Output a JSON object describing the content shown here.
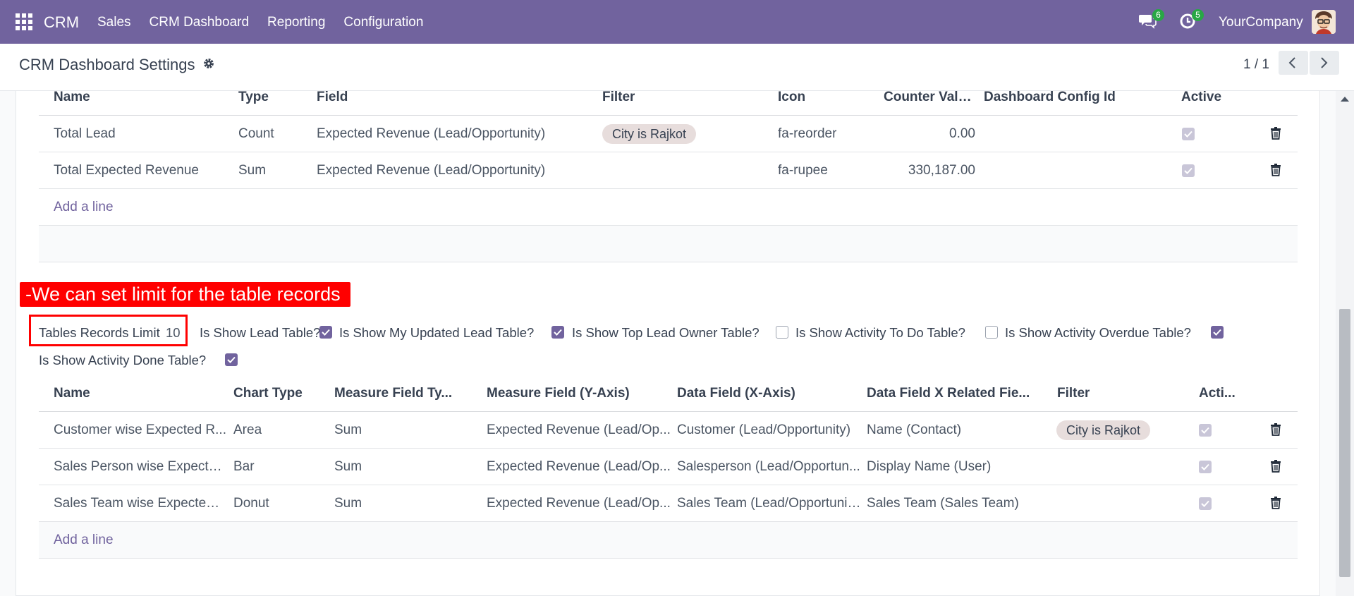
{
  "navbar": {
    "brand": "CRM",
    "menu": [
      "Sales",
      "CRM Dashboard",
      "Reporting",
      "Configuration"
    ],
    "messages_count": "6",
    "activities_count": "5",
    "company": "YourCompany",
    "colors": {
      "navbar": "#71639e",
      "badge": "#28a745"
    }
  },
  "control": {
    "title": "CRM Dashboard Settings",
    "pager": "1 / 1"
  },
  "counter_table": {
    "headers": [
      "Name",
      "Type",
      "Field",
      "Filter",
      "Icon",
      "Counter Values",
      "Dashboard Config Id",
      "Active"
    ],
    "rows": [
      {
        "name": "Total Lead",
        "type": "Count",
        "field": "Expected Revenue (Lead/Opportunity)",
        "filter": "City is Rajkot",
        "icon": "fa-reorder",
        "counter": "0.00",
        "config": "",
        "active": true
      },
      {
        "name": "Total Expected Revenue",
        "type": "Sum",
        "field": "Expected Revenue (Lead/Opportunity)",
        "filter": "",
        "icon": "fa-rupee",
        "counter": "330,187.00",
        "config": "",
        "active": true
      }
    ],
    "add_line": "Add a line"
  },
  "annotation": "-We can set limit for the table records",
  "options": {
    "limit_label": "Tables Records Limit",
    "limit_value": "10",
    "items": [
      {
        "label": "Is Show Lead Table?",
        "checked": true
      },
      {
        "label": "Is Show My Updated Lead Table?",
        "checked": true
      },
      {
        "label": "Is Show Top Lead Owner Table?",
        "checked": false
      },
      {
        "label": "Is Show Activity To Do Table?",
        "checked": false
      },
      {
        "label": "Is Show Activity Overdue Table?",
        "checked": true
      },
      {
        "label": "Is Show Activity Done Table?",
        "checked": true
      }
    ]
  },
  "chart_table": {
    "headers": [
      "Name",
      "Chart Type",
      "Measure Field Ty...",
      "Measure Field (Y-Axis)",
      "Data Field (X-Axis)",
      "Data Field X Related Fie...",
      "Filter",
      "Acti..."
    ],
    "rows": [
      {
        "name": "Customer wise Expected R...",
        "chart_type": "Area",
        "measure_type": "Sum",
        "measure_field": "Expected Revenue (Lead/Op...",
        "data_field": "Customer (Lead/Opportunity)",
        "related": "Name (Contact)",
        "filter": "City is Rajkot",
        "active": true
      },
      {
        "name": "Sales Person wise Expected...",
        "chart_type": "Bar",
        "measure_type": "Sum",
        "measure_field": "Expected Revenue (Lead/Op...",
        "data_field": "Salesperson (Lead/Opportun...",
        "related": "Display Name (User)",
        "filter": "",
        "active": true
      },
      {
        "name": "Sales Team wise Expected ...",
        "chart_type": "Donut",
        "measure_type": "Sum",
        "measure_field": "Expected Revenue (Lead/Op...",
        "data_field": "Sales Team (Lead/Opportunity)",
        "related": "Sales Team (Sales Team)",
        "filter": "",
        "active": true
      }
    ],
    "add_line": "Add a line"
  }
}
